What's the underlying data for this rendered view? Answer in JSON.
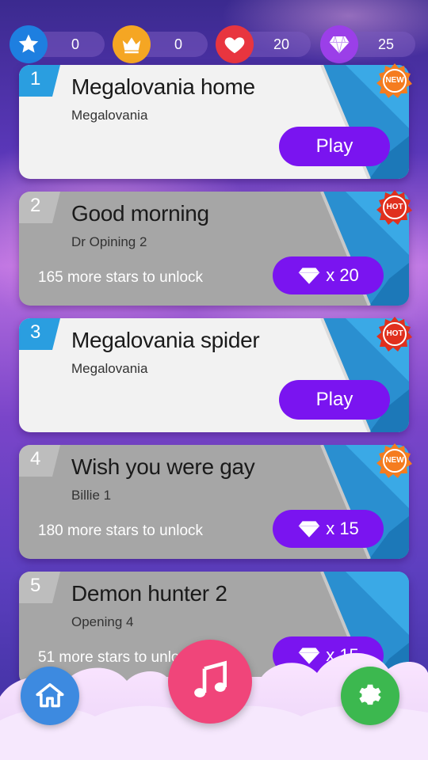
{
  "stats": {
    "stars": "0",
    "crowns": "0",
    "hearts": "20",
    "gems": "25"
  },
  "songs": [
    {
      "number": "1",
      "title": "Megalovania home",
      "artist": "Megalovania",
      "badge": "NEW",
      "status": "unlocked",
      "play_label": "Play"
    },
    {
      "number": "2",
      "title": "Good morning",
      "artist": "Dr Opining 2",
      "badge": "HOT",
      "status": "locked",
      "unlock_text": "165 more stars to unlock",
      "gem_cost": "x 20"
    },
    {
      "number": "3",
      "title": "Megalovania spider",
      "artist": "Megalovania",
      "badge": "HOT",
      "status": "unlocked",
      "play_label": "Play"
    },
    {
      "number": "4",
      "title": "Wish you were gay",
      "artist": "Billie 1",
      "badge": "NEW",
      "status": "locked",
      "unlock_text": "180 more stars to unlock",
      "gem_cost": "x 15"
    },
    {
      "number": "5",
      "title": "Demon hunter 2",
      "artist": "Opening 4",
      "status": "locked",
      "unlock_text": "51 more stars to unlock",
      "gem_cost": "x 15"
    }
  ],
  "icons": {
    "stars": "star-icon",
    "crowns": "crown-icon",
    "hearts": "heart-icon",
    "gems": "diamond-icon",
    "home": "home-icon",
    "music": "music-note-icon",
    "settings": "gear-icon"
  },
  "colors": {
    "play_button": "#7a14f0",
    "card_locked": "#a6a6a6",
    "card_unlocked": "#f2f2f2",
    "badge_new": "#f57c1f",
    "badge_hot": "#e0301e",
    "home_button": "#3d8ae0",
    "music_button": "#f0457a",
    "settings_button": "#3cb84f"
  }
}
